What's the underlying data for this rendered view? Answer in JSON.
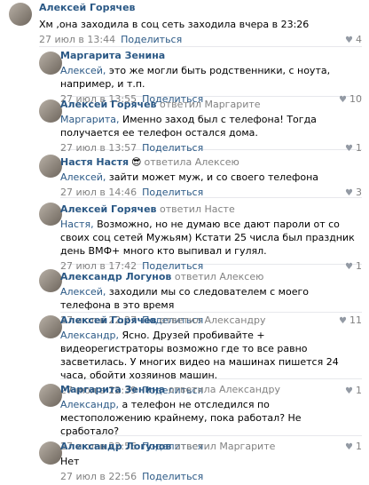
{
  "comments": [
    {
      "author": "Алексей Горячев",
      "replied_text": "",
      "mention": "",
      "text": "Хм ,она заходила в соц сеть заходила вчера в 23:26",
      "date": "27 июл в 13:44",
      "share": "Поделиться",
      "likes": "4"
    },
    {
      "author": "Маргарита Зенина",
      "replied_text": "",
      "mention": "Алексей,",
      "text": " это же могли быть родственники, с ноута, например, и т.п.",
      "date": "27 июл в 13:55",
      "share": "Поделиться",
      "likes": "10"
    },
    {
      "author": "Алексей Горячев",
      "replied_text": "ответил Маргарите",
      "mention": "Маргарита,",
      "text": " Именно заход был с телефона! Тогда получается ее телефон остался дома.",
      "date": "27 июл в 13:57",
      "share": "Поделиться",
      "likes": "1"
    },
    {
      "author": "Настя Настя",
      "emoji": "😎",
      "replied_text": "ответила Алексею",
      "mention": "Алексей,",
      "text": " зайти может муж, и со своего телефона",
      "date": "27 июл в 14:46",
      "share": "Поделиться",
      "likes": "3"
    },
    {
      "author": "Алексей Горячев",
      "replied_text": "ответил Насте",
      "mention": "Настя,",
      "text": " Возможно, но не думаю все дают пароли от со своих соц сетей Мужьям) Кстати 25 числа был праздник день ВМФ+ много кто выпивал и гулял.",
      "date": "27 июл в 17:42",
      "share": "Поделиться",
      "likes": "1"
    },
    {
      "author": "Александр Логунов",
      "replied_text": "ответил Алексею",
      "mention": "Алексей,",
      "text": " заходили мы со следователем с моего телефона в это время",
      "date": "27 июл в 22:27",
      "share": "Поделиться",
      "likes": "11"
    },
    {
      "author": "Алексей Горячев",
      "replied_text": "ответил Александру",
      "mention": "Александр,",
      "text": " Ясно. Друзей пробивайте + видеорегистраторы возможно где то все равно засветилась. У многих видео на машинах пишется 24 часа, обойти хозяинов машин.",
      "date": "27 июл в 22:39",
      "share": "Поделиться",
      "likes": "1"
    },
    {
      "author": "Маргарита Зенина",
      "replied_text": "ответила Александру",
      "mention": "Александр,",
      "text": " а телефон не отследился по местоположению крайнему, пока работал? Не сработало?",
      "date": "27 июл в 22:56",
      "share": "Поделиться",
      "likes": "1"
    },
    {
      "author": "Александр Логунов",
      "replied_text": "ответил Маргарите",
      "mention": "",
      "text": "Нет",
      "date": "27 июл в 22:56",
      "share": "Поделиться",
      "likes": ""
    }
  ],
  "colors": {
    "link": "#2a5885",
    "meta": "#828282",
    "divider": "#e7e8ec"
  }
}
